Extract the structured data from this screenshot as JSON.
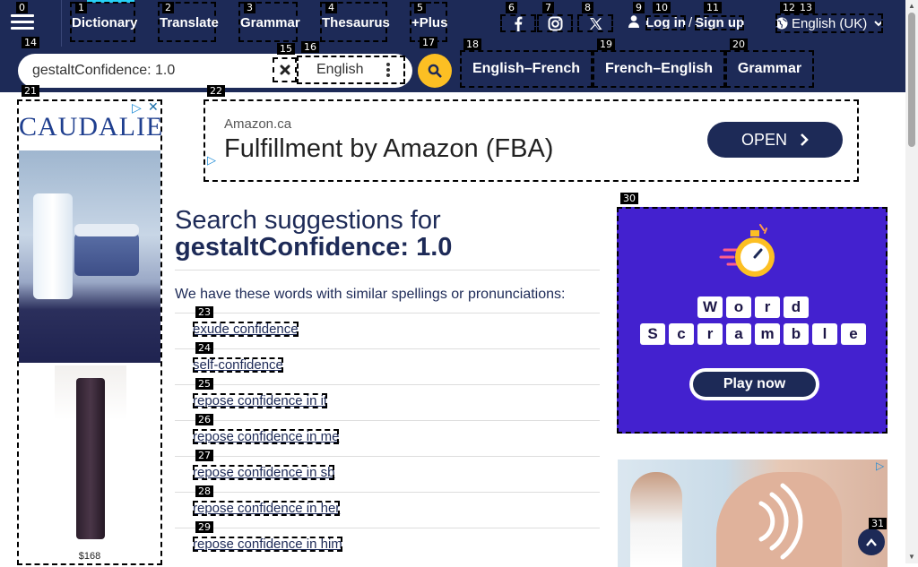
{
  "nav": {
    "items": [
      "Dictionary",
      "Translate",
      "Grammar",
      "Thesaurus",
      "+Plus"
    ],
    "login": "Log in",
    "slash": "/",
    "signup": "Sign up",
    "language": "English (UK)"
  },
  "markers": [
    "0",
    "1",
    "2",
    "3",
    "4",
    "5",
    "6",
    "7",
    "8",
    "9",
    "10",
    "11",
    "12",
    "13",
    "14",
    "15",
    "16",
    "17",
    "18",
    "19",
    "20",
    "21",
    "22",
    "23",
    "24",
    "25",
    "26",
    "27",
    "28",
    "29",
    "30",
    "31"
  ],
  "search": {
    "value": "gestaltConfidence: 1.0",
    "language": "English"
  },
  "dict_links": [
    "English–French",
    "French–English",
    "Grammar"
  ],
  "ads": {
    "caudalie_brand": "CAUDALIE",
    "caudalie_price": "$168",
    "amazon_source": "Amazon.ca",
    "amazon_title": "Fulfillment by Amazon (FBA)",
    "amazon_cta": "OPEN",
    "wordscramble_row1": [
      "W",
      "o",
      "r",
      "d"
    ],
    "wordscramble_row2": [
      "S",
      "c",
      "r",
      "a",
      "m",
      "b",
      "l",
      "e"
    ],
    "wordscramble_cta": "Play now"
  },
  "main": {
    "heading_prefix": "Search suggestions for",
    "heading_query": "gestaltConfidence: 1.0",
    "intro": "We have these words with similar spellings or pronunciations:",
    "suggestions": [
      "exude confidence",
      "self-confidence",
      "repose confidence in it",
      "repose confidence in me",
      "repose confidence in sb",
      "repose confidence in her",
      "repose confidence in him"
    ]
  },
  "colors": {
    "brand": "#1d2a57",
    "accent": "#fcbf23",
    "active": "#27d0f5",
    "wordscramble_bg": "#4321cf"
  }
}
